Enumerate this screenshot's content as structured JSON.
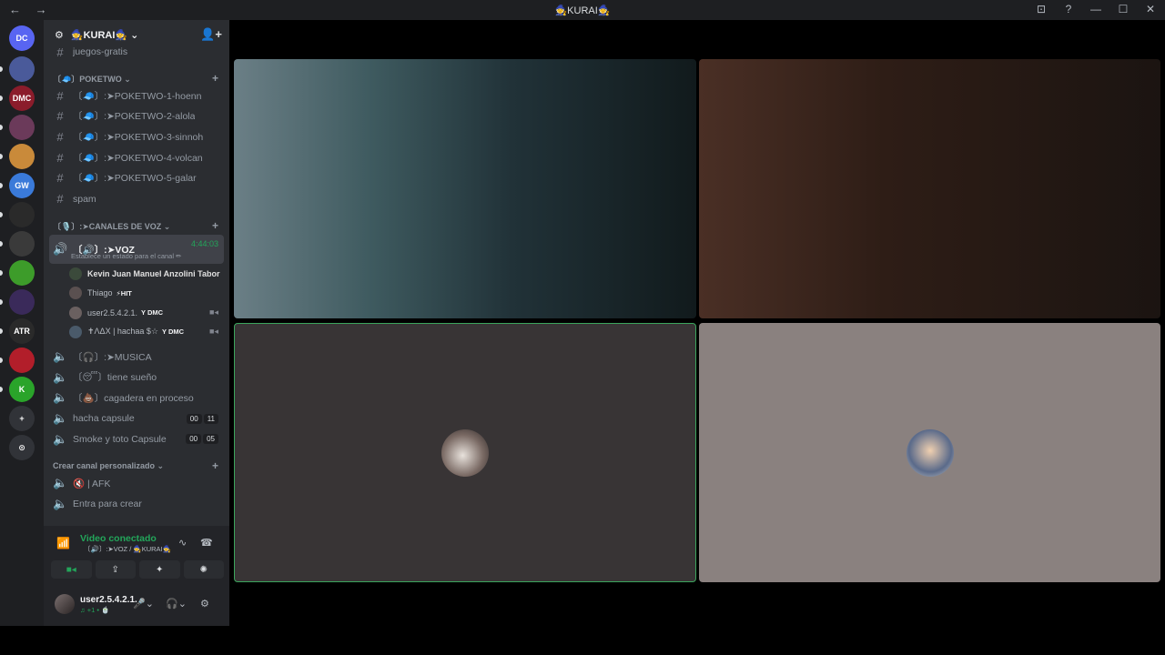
{
  "window": {
    "nav": "← →",
    "title": "🧙KURAI🧙",
    "controls": [
      "⊡",
      "?",
      "—",
      "☐",
      "✕"
    ]
  },
  "guilds": [
    {
      "label": "DC",
      "color": "#5865f2"
    },
    {
      "label": "",
      "color": "#4a5a9a"
    },
    {
      "label": "DMC",
      "color": "#8b1c2b"
    },
    {
      "label": "",
      "color": "#6b3a5a"
    },
    {
      "label": "",
      "color": "#c98a3a"
    },
    {
      "label": "GW",
      "color": "#3a7ad9"
    },
    {
      "label": "",
      "color": "#2a2a2a"
    },
    {
      "label": "",
      "color": "#3a3a3a"
    },
    {
      "label": "",
      "color": "#3d9c2a"
    },
    {
      "label": "",
      "color": "#3a2a5a"
    },
    {
      "label": "ATR",
      "color": "#2a2a2a"
    },
    {
      "label": "",
      "color": "#b21e2a"
    },
    {
      "label": "K",
      "color": "#2aa42a"
    },
    {
      "label": "+",
      "color": "#313338"
    },
    {
      "label": "⊙",
      "color": "#313338"
    }
  ],
  "server": {
    "name": "🧙KURAI🧙 ⌄",
    "channels_top": [
      {
        "label": "juegos-gratis"
      }
    ],
    "category_poketwo": "〔🧢〕POKETWO ⌄",
    "poketwo": [
      {
        "label": "〔🧢〕:➤POKETWO-1-hoenn"
      },
      {
        "label": "〔🧢〕:➤POKETWO-2-alola"
      },
      {
        "label": "〔🧢〕:➤POKETWO-3-sinnoh"
      },
      {
        "label": "〔🧢〕:➤POKETWO-4-volcan"
      },
      {
        "label": "〔🧢〕:➤POKETWO-5-galar"
      },
      {
        "label": "spam"
      }
    ],
    "category_voice": "〔🎙️〕:➤CANALES DE VOZ ⌄",
    "voz": {
      "label": "〔🔊〕:➤VOZ",
      "timer": "4:44:03",
      "status": "Establece un estado para el canal ✏"
    },
    "voz_users": [
      {
        "name": "Kevin Juan Manuel Anzolini Tabor",
        "badge": "",
        "cam": "",
        "color": "#e0e0e0",
        "av": "#3b4a3b"
      },
      {
        "name": "Thiago",
        "badge": "⚡HIT",
        "cam": "",
        "color": "#b5bac1",
        "av": "#5a5050"
      },
      {
        "name": "user2.5.4.2.1.",
        "badge": "Y DMC",
        "cam": "■◂",
        "color": "#b5bac1",
        "av": "#6a6060"
      },
      {
        "name": "✝ΛΔX | hachaa $☆",
        "badge": "Y DMC",
        "cam": "■◂",
        "color": "#b5bac1",
        "av": "#4a5a6a"
      }
    ],
    "voice_channels": [
      {
        "label": "〔🎧〕:➤MUSICA",
        "count": []
      },
      {
        "label": "〔😴〕tiene sueño",
        "count": []
      },
      {
        "label": "〔💩〕cagadera en proceso",
        "count": []
      },
      {
        "label": "hacha capsule",
        "count": [
          "00",
          "11"
        ]
      },
      {
        "label": "Smoke y toto Capsule",
        "count": [
          "00",
          "05"
        ]
      }
    ],
    "category_custom": "Crear canal personalizado ⌄",
    "custom": [
      {
        "label": "🔇 | AFK"
      },
      {
        "label": "Entra para crear"
      }
    ]
  },
  "voice_panel": {
    "title": "Video conectado",
    "sub": "〔🔊〕:➤VOZ / 🧙KURAI🧙",
    "buttons": [
      "■◂",
      "⇪",
      "✦",
      "✺"
    ]
  },
  "user": {
    "name": "user2.5.4.2.1.",
    "status": "♫ +1 • 🍵"
  },
  "tiles": [
    {
      "kind": "video"
    },
    {
      "kind": "video"
    },
    {
      "kind": "avatar",
      "av": "#7a6a64"
    },
    {
      "kind": "avatar",
      "av": "#5a6a8a"
    }
  ]
}
